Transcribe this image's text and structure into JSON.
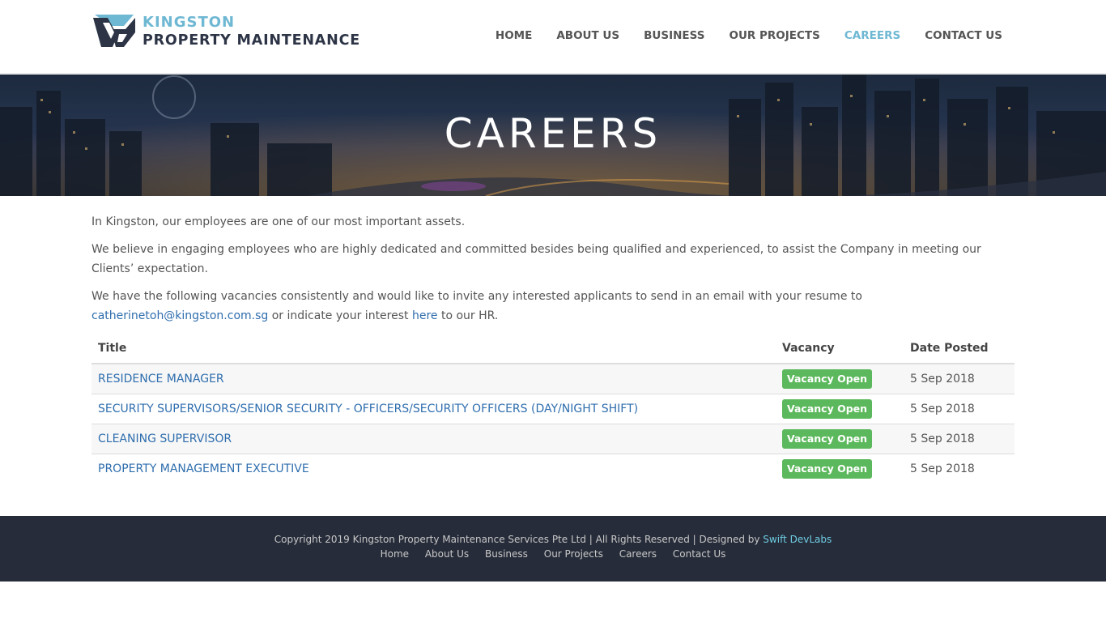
{
  "brand": {
    "name_top": "KINGSTON",
    "name_bottom": "PROPERTY MAINTENANCE",
    "accent_color": "#6fb8d3",
    "dark_color": "#2c3446"
  },
  "nav": {
    "items": [
      "HOME",
      "ABOUT US",
      "BUSINESS",
      "OUR PROJECTS",
      "CAREERS",
      "CONTACT US"
    ],
    "active": "CAREERS"
  },
  "hero": {
    "title": "CAREERS"
  },
  "intro": {
    "p1": "In Kingston, our employees are one of our most important assets.",
    "p2": "We believe in engaging employees who are highly dedicated and committed besides being qualified and experienced, to assist the Company in meeting our Clients’ expectation.",
    "p3_before": "We have the following vacancies consistently and would like to invite any interested applicants to send in an email with your resume to ",
    "email": "catherinetoh@kingston.com.sg",
    "p3_middle": " or indicate your interest ",
    "here_link": "here",
    "p3_after": " to our HR."
  },
  "table": {
    "headers": [
      "Title",
      "Vacancy",
      "Date Posted"
    ],
    "rows": [
      {
        "title": "RESIDENCE MANAGER",
        "vacancy": "Vacancy Open",
        "date": "5 Sep 2018"
      },
      {
        "title": "SECURITY SUPERVISORS/SENIOR SECURITY - OFFICERS/SECURITY OFFICERS (DAY/NIGHT SHIFT)",
        "vacancy": "Vacancy Open",
        "date": "5 Sep 2018"
      },
      {
        "title": "CLEANING SUPERVISOR",
        "vacancy": "Vacancy Open",
        "date": "5 Sep 2018"
      },
      {
        "title": "PROPERTY MANAGEMENT EXECUTIVE",
        "vacancy": "Vacancy Open",
        "date": "5 Sep 2018"
      }
    ],
    "badge_color": "#5cb85c"
  },
  "footer": {
    "copyright": "Copyright 2019 Kingston Property Maintenance Services Pte Ltd | All Rights Reserved | Designed by ",
    "designer": "Swift DevLabs",
    "links": [
      "Home",
      "About Us",
      "Business",
      "Our Projects",
      "Careers",
      "Contact Us"
    ]
  }
}
